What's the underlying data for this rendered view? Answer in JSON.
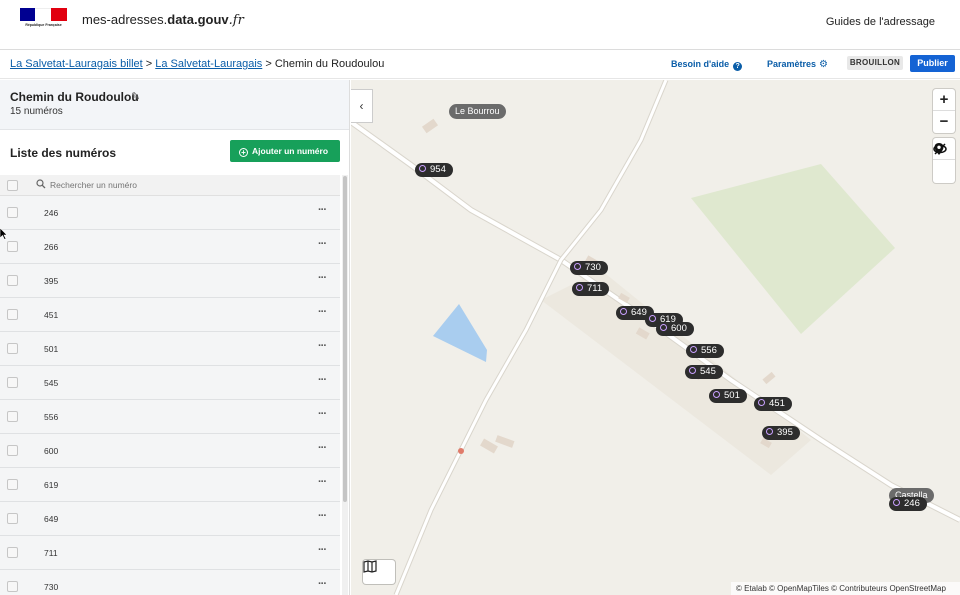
{
  "header": {
    "logo_text": "République Française",
    "site_name_prefix": "mes-adresses.",
    "site_name_bold": "data.gouv",
    "site_name_suffix": ".fr",
    "guides_link": "Guides de l'adressage"
  },
  "toolbar": {
    "crumbs": [
      {
        "label": "La Salvetat-Lauragais billet",
        "link": true
      },
      {
        "label": "La Salvetat-Lauragais",
        "link": true
      },
      {
        "label": "Chemin du Roudoulou",
        "link": false
      }
    ],
    "separator": ">",
    "help_label": "Besoin d'aide",
    "help_icon": "question-circle-icon",
    "settings_label": "Paramètres",
    "settings_icon": "gear-icon",
    "status_badge": "BROUILLON",
    "publish_label": "Publier"
  },
  "panel": {
    "street_name": "Chemin du Roudoulou",
    "street_count": "15 numéros",
    "list_title": "Liste des numéros",
    "add_button_label": "Ajouter un numéro",
    "search_placeholder": "Rechercher un numéro",
    "rows": [
      "246",
      "266",
      "395",
      "451",
      "501",
      "545",
      "556",
      "600",
      "619",
      "649",
      "711",
      "730"
    ],
    "row_menu_label": "···"
  },
  "map": {
    "place_labels": [
      "Le Bourrou",
      "Castella"
    ],
    "markers": [
      "954",
      "730",
      "711",
      "649",
      "619",
      "600",
      "556",
      "545",
      "501",
      "451",
      "395",
      "246"
    ],
    "attribution": "© Etalab © OpenMapTiles © Contributeurs OpenStreetMap",
    "colors": {
      "background": "#f1efe9",
      "road": "#ffffff",
      "field": "#dfe8cf",
      "water": "#a9cdef",
      "marker": "#2d2d2d",
      "marker_ring": "#c9a0ff"
    }
  }
}
